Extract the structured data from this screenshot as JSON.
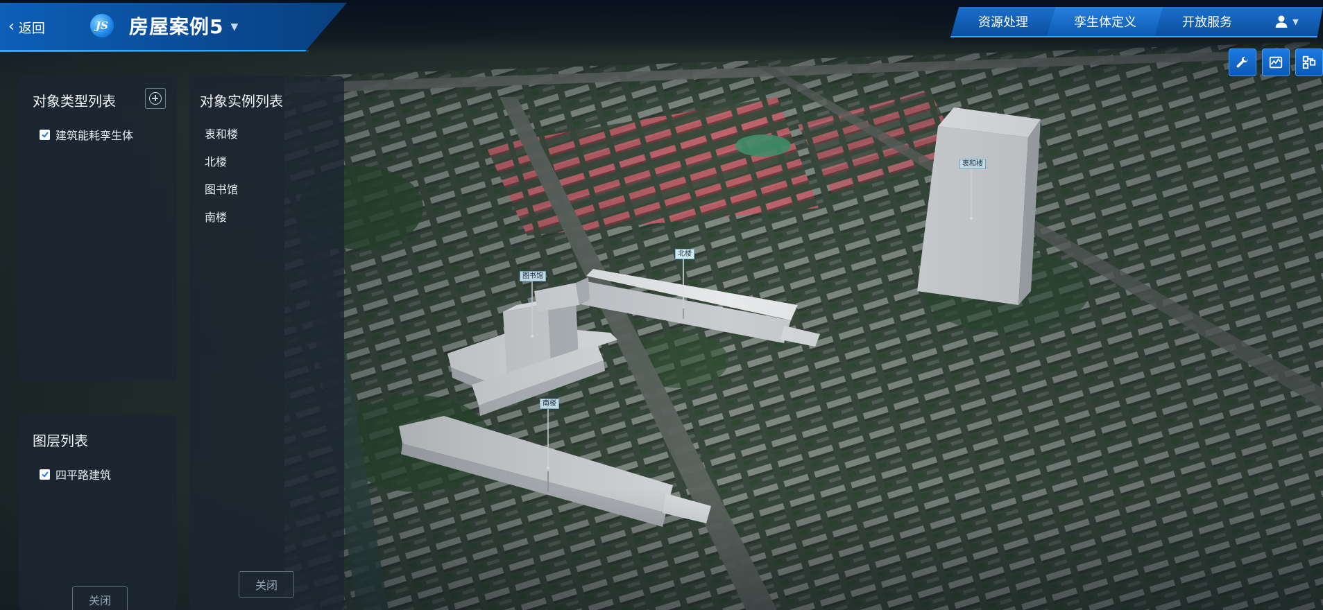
{
  "header": {
    "back_label": "返回",
    "logo_text": "JS",
    "project_title": "房屋案例5",
    "nav_tabs": [
      "资源处理",
      "孪生体定义",
      "开放服务"
    ],
    "active_tab": "孪生体定义",
    "accent_color": "#0d5fb8",
    "highlight_color": "#37a5ff"
  },
  "toolbar": {
    "icons": [
      "wrench-icon",
      "chart-icon",
      "node-icon"
    ]
  },
  "types_panel": {
    "title": "对象类型列表",
    "items": [
      {
        "label": "建筑能耗孪生体",
        "checked": true
      }
    ]
  },
  "layers_panel": {
    "title": "图层列表",
    "items": [
      {
        "label": "四平路建筑",
        "checked": true
      }
    ],
    "close_label": "关闭"
  },
  "instances_panel": {
    "title": "对象实例列表",
    "items": [
      "衷和楼",
      "北楼",
      "图书馆",
      "南楼"
    ],
    "close_label": "关闭"
  },
  "map_labels": {
    "zhonghe": "衷和楼",
    "north": "北楼",
    "library": "图书馆",
    "south": "南楼"
  }
}
